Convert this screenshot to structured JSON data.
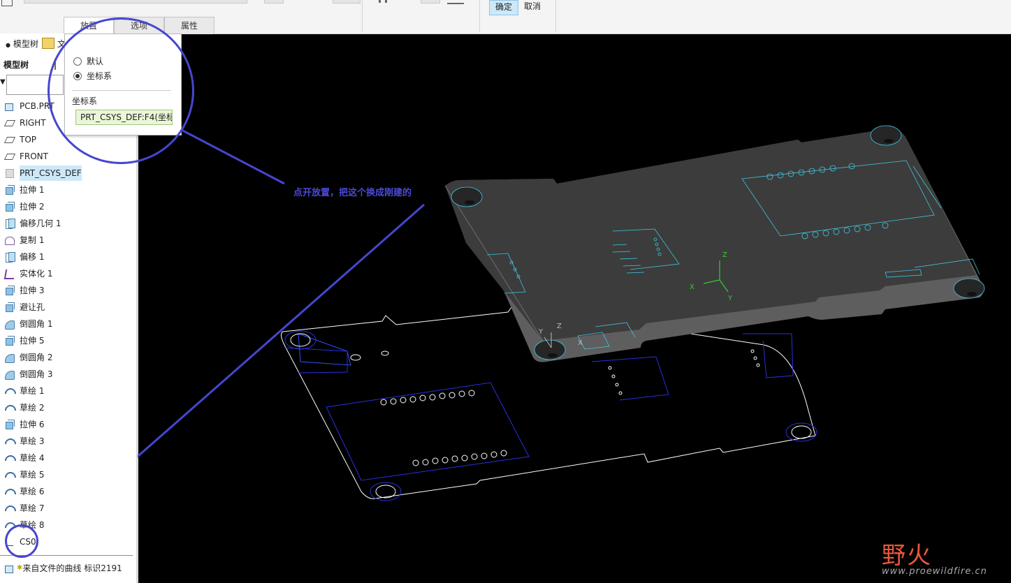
{
  "ribbon": {
    "ok_label": "确定",
    "cancel_label": "取消",
    "tabs": [
      "放置",
      "选项",
      "属性"
    ]
  },
  "left_panel": {
    "tab_model_tree": "模型树",
    "tab_second": "文",
    "heading": "模型树",
    "tree": [
      {
        "label": "PCB.PRT",
        "icon": "part-icon"
      },
      {
        "label": "RIGHT",
        "icon": "datum-plane-icon"
      },
      {
        "label": "TOP",
        "icon": "datum-plane-icon"
      },
      {
        "label": "FRONT",
        "icon": "datum-plane-icon"
      },
      {
        "label": "PRT_CSYS_DEF",
        "icon": "csys-icon"
      },
      {
        "label": "拉伸 1",
        "icon": "extrude-icon"
      },
      {
        "label": "拉伸 2",
        "icon": "extrude-icon"
      },
      {
        "label": "偏移几何 1",
        "icon": "offset-geometry-icon"
      },
      {
        "label": "复制 1",
        "icon": "copy-icon"
      },
      {
        "label": "偏移 1",
        "icon": "offset-icon"
      },
      {
        "label": "实体化 1",
        "icon": "solidify-icon"
      },
      {
        "label": "拉伸 3",
        "icon": "extrude-icon"
      },
      {
        "label": "避让孔",
        "icon": "extrude-icon"
      },
      {
        "label": "倒圆角 1",
        "icon": "round-icon"
      },
      {
        "label": "拉伸 5",
        "icon": "extrude-icon"
      },
      {
        "label": "倒圆角 2",
        "icon": "round-icon"
      },
      {
        "label": "倒圆角 3",
        "icon": "round-icon"
      },
      {
        "label": "草绘 1",
        "icon": "sketch-icon"
      },
      {
        "label": "草绘 2",
        "icon": "sketch-icon"
      },
      {
        "label": "拉伸 6",
        "icon": "extrude-icon"
      },
      {
        "label": "草绘 3",
        "icon": "sketch-icon"
      },
      {
        "label": "草绘 4",
        "icon": "sketch-icon"
      },
      {
        "label": "草绘 5",
        "icon": "sketch-icon"
      },
      {
        "label": "草绘 6",
        "icon": "sketch-icon"
      },
      {
        "label": "草绘 7",
        "icon": "sketch-icon"
      },
      {
        "label": "草绘 8",
        "icon": "sketch-icon"
      },
      {
        "label": "CS0",
        "icon": "csys-icon"
      }
    ],
    "footer_item": "来自文件的曲线 标识2191"
  },
  "placement_popup": {
    "option_default": "默认",
    "option_csys": "坐标系",
    "selected": "坐标系",
    "csys_label": "坐标系",
    "csys_value": "PRT_CSYS_DEF:F4(坐标"
  },
  "annotation": {
    "note": "点开放置，把这个换成刚建的",
    "color": "#4a4ad8"
  },
  "viewport": {
    "axis_labels": [
      "Z",
      "X",
      "Y"
    ],
    "background": "#000000"
  },
  "watermark": {
    "brand": "野火",
    "url": "www.proewildfire.cn"
  }
}
